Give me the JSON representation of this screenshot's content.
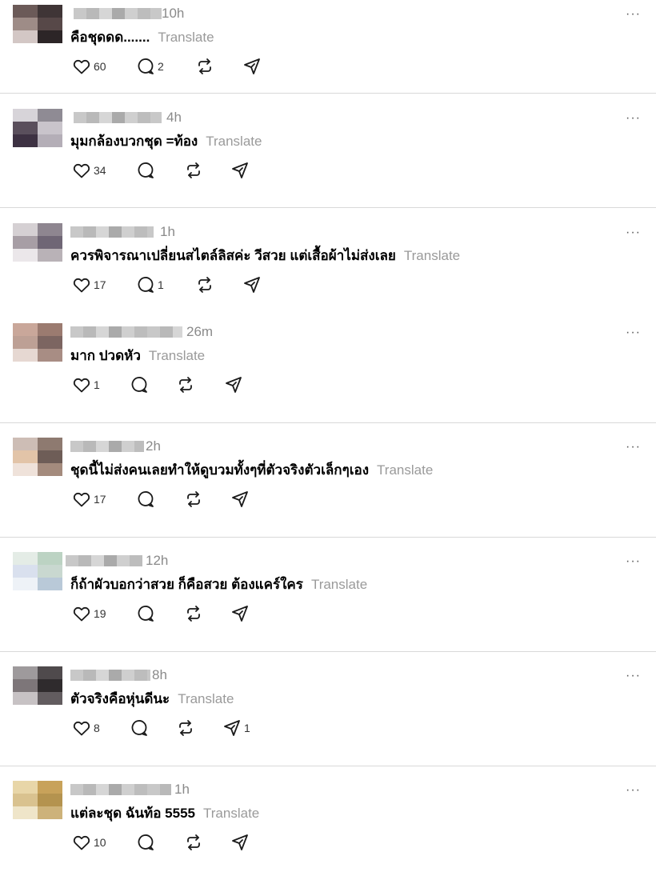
{
  "colors": {
    "divider": "#d9d9d9",
    "icon": "#1a1a1a",
    "muted": "#9a9a9a"
  },
  "more_label": "···",
  "translate_label": "Translate",
  "posts": [
    {
      "time": "10h",
      "text": "คือชุดดด.......",
      "likes": "60",
      "replies": "2",
      "shares": "",
      "avatar": [
        "#6b5a58",
        "#3f3536",
        "#9e8c87",
        "#574848",
        "#d3c7c5",
        "#2c2527"
      ]
    },
    {
      "time": "4h",
      "text": "มุมกล้องบวกชุด =ท้อง",
      "likes": "34",
      "replies": "",
      "shares": "",
      "avatar": [
        "#d7d4d9",
        "#8f8b94",
        "#5a4f5c",
        "#c9c4cb",
        "#3d3142",
        "#b4aeb7"
      ]
    },
    {
      "time": "1h",
      "text": "ควรพิจารณาเปลี่ยนสไตล์ลิสค่ะ วีสวย แต่เสื้อผ้าไม่ส่งเลย",
      "likes": "17",
      "replies": "1",
      "shares": "",
      "avatar": [
        "#d5d0d3",
        "#8e8690",
        "#a79ea5",
        "#6f6675",
        "#ebe7ea",
        "#b9b2b7"
      ]
    },
    {
      "time": "26m",
      "text": "มาก ปวดหัว",
      "likes": "1",
      "replies": "",
      "shares": "",
      "avatar": [
        "#c9a79a",
        "#9b7b70",
        "#bda095",
        "#7c6561",
        "#e6d8d2",
        "#a88d84"
      ]
    },
    {
      "time": "2h",
      "text": "ชุดนี้ไม่ส่งคนเลยทำให้ดูบวมทั้งๆที่ตัวจริงตัวเล็กๆเอง",
      "likes": "17",
      "replies": "",
      "shares": "",
      "avatar": [
        "#cdbdb5",
        "#8e7a70",
        "#e2c4a8",
        "#6e5d57",
        "#efe2da",
        "#a48b7d"
      ]
    },
    {
      "time": "12h",
      "text": "ก็ถ้าผัวบอกว่าสวย ก็คือสวย ต้องแคร์ใคร",
      "likes": "19",
      "replies": "",
      "shares": "",
      "avatar": [
        "#e4ece6",
        "#bcd3c3",
        "#d9e0ee",
        "#c9d8d0",
        "#eef2f7",
        "#b9c9d8"
      ]
    },
    {
      "time": "8h",
      "text": "ตัวจริงคือหุ่นดีนะ",
      "likes": "8",
      "replies": "",
      "shares": "1",
      "avatar": [
        "#9e9a9c",
        "#4f4a4c",
        "#7d7679",
        "#2f2b2d",
        "#c7c2c4",
        "#625c5f"
      ]
    },
    {
      "time": "1h",
      "text": "แต่ละชุด ฉันท้อ 5555",
      "likes": "10",
      "replies": "",
      "shares": "",
      "avatar": [
        "#e8d6a8",
        "#c8a25a",
        "#d9c28f",
        "#b4934f",
        "#efe5c9",
        "#cdb27a"
      ]
    }
  ]
}
